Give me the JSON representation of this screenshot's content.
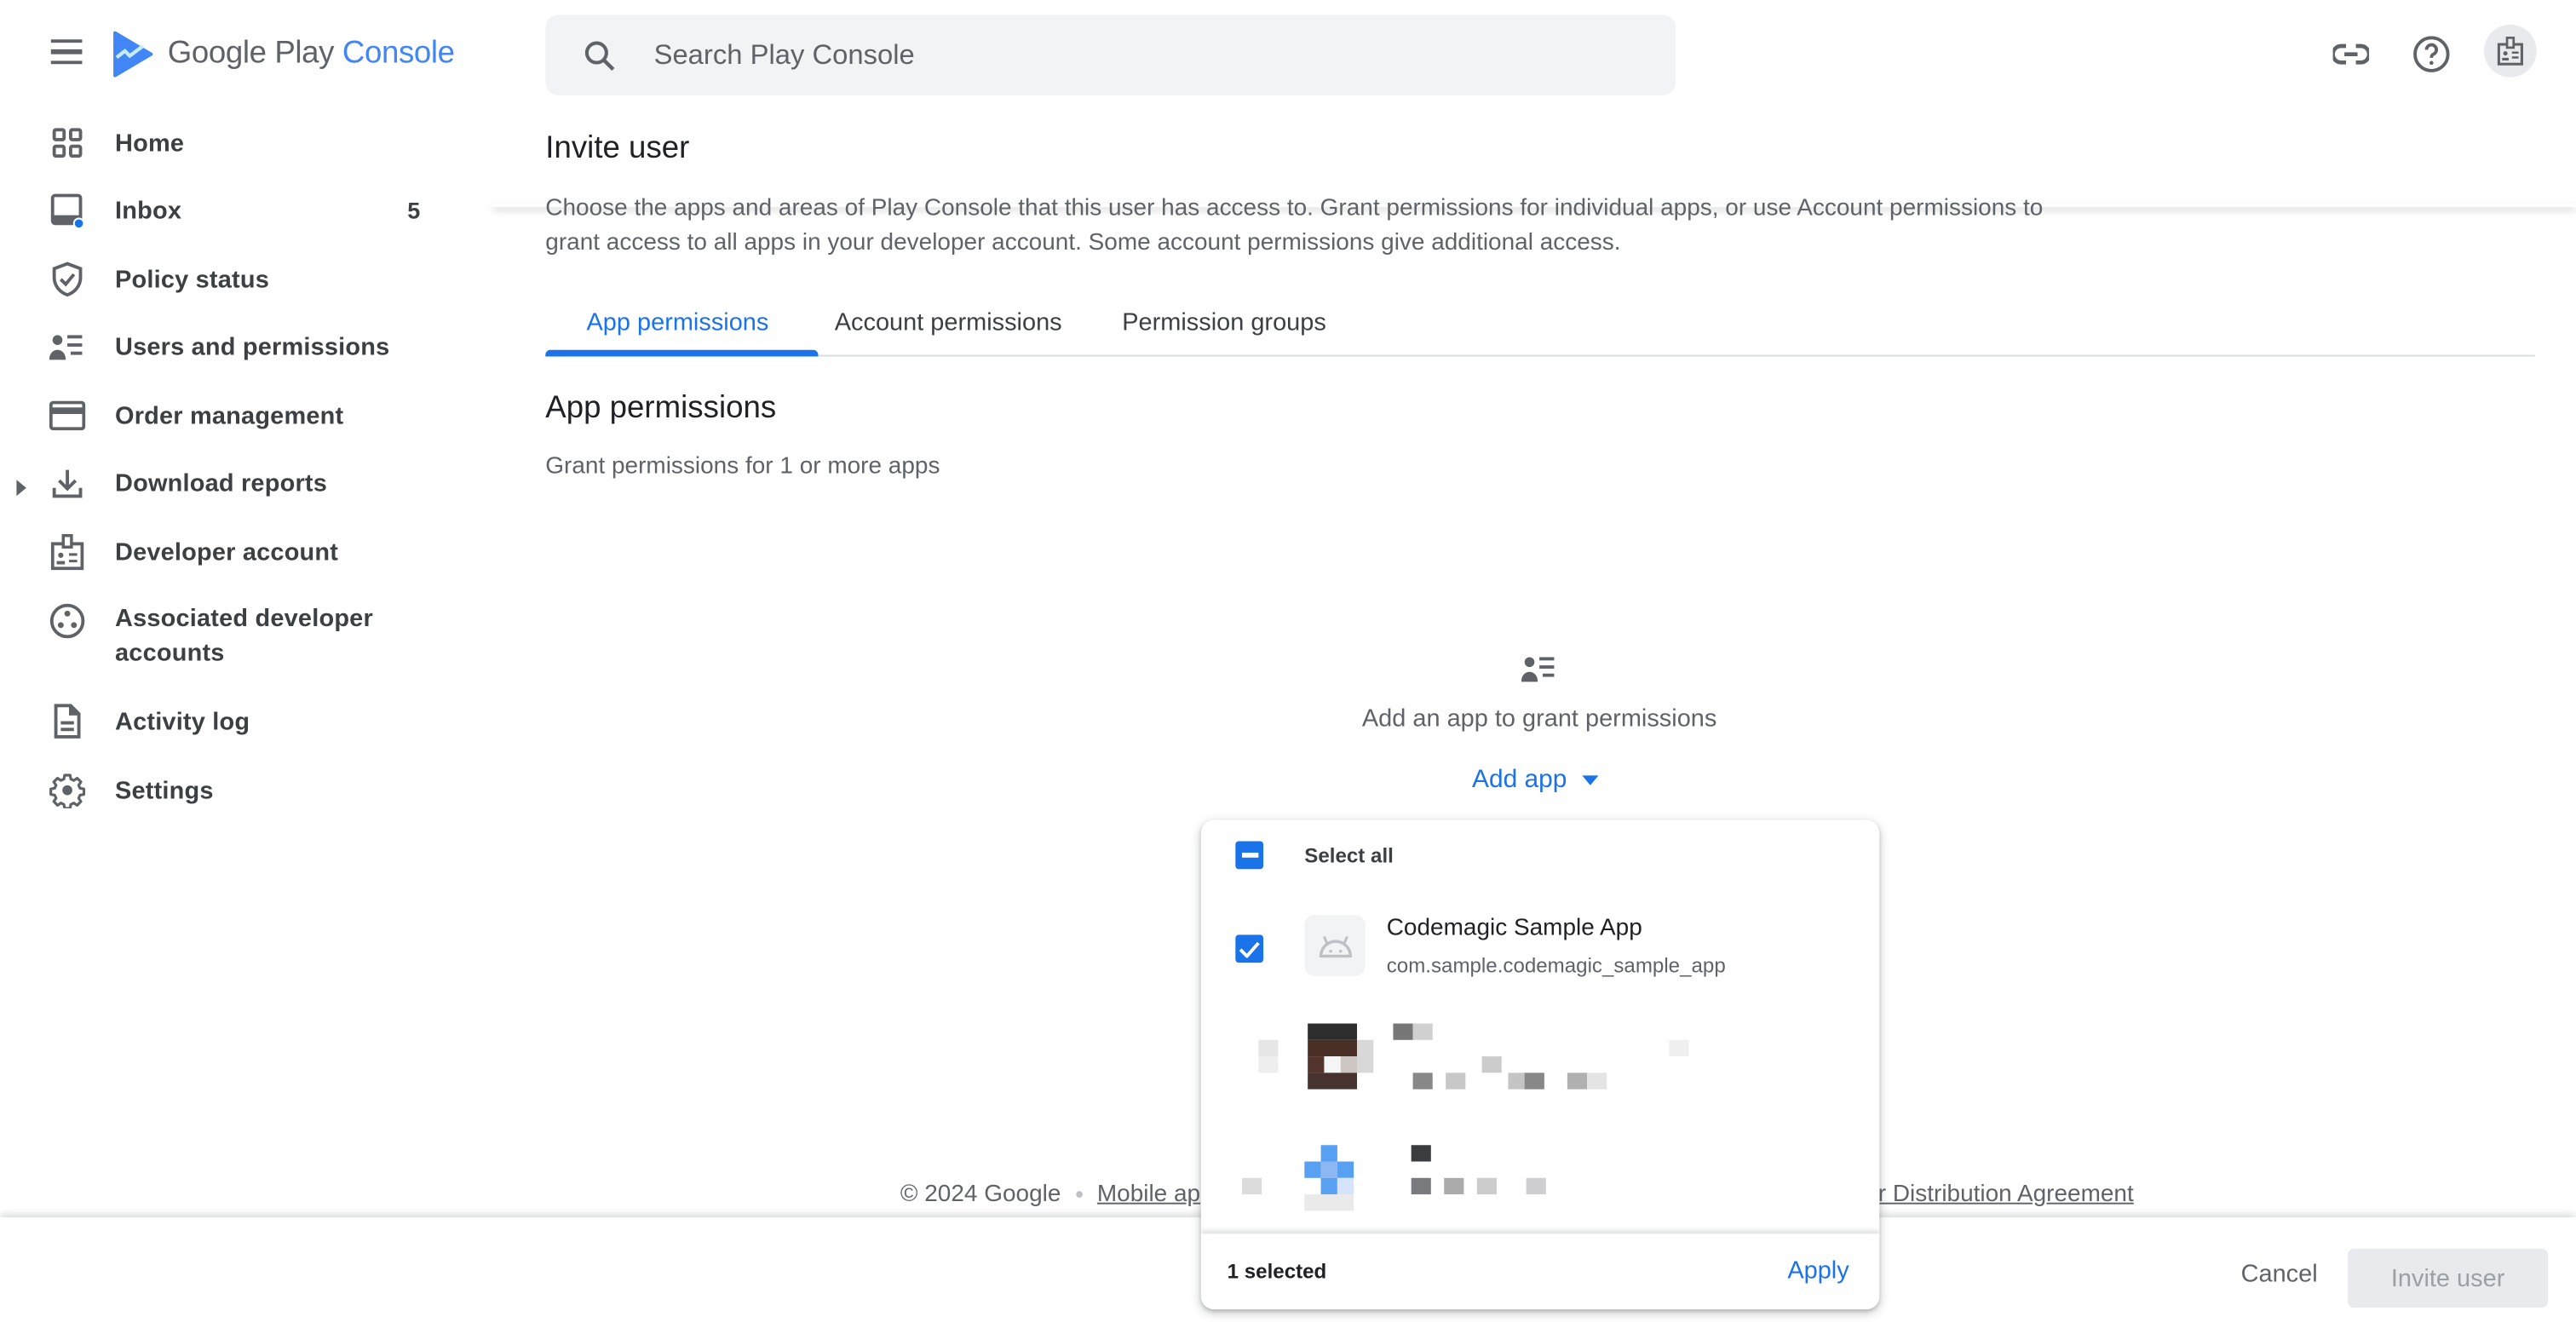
{
  "header": {
    "logo_text_main": "Google Play",
    "logo_text_accent": "Console",
    "search_placeholder": "Search Play Console",
    "icons": [
      "link-icon",
      "help-icon",
      "account-badge-icon"
    ]
  },
  "sidebar": {
    "items": [
      {
        "label": "Home",
        "icon": "home-grid-icon"
      },
      {
        "label": "Inbox",
        "icon": "inbox-icon",
        "badge": "5"
      },
      {
        "label": "Policy status",
        "icon": "shield-check-icon"
      },
      {
        "label": "Users and permissions",
        "icon": "users-list-icon"
      },
      {
        "label": "Order management",
        "icon": "credit-card-icon"
      },
      {
        "label": "Download reports",
        "icon": "download-icon",
        "expandable": true
      },
      {
        "label": "Developer account",
        "icon": "id-badge-icon"
      },
      {
        "label": "Associated developer accounts",
        "icon": "linked-accounts-icon"
      },
      {
        "label": "Activity log",
        "icon": "document-icon"
      },
      {
        "label": "Settings",
        "icon": "gear-icon"
      }
    ]
  },
  "page": {
    "title": "Invite user",
    "description": "Choose the apps and areas of Play Console that this user has access to. Grant permissions for individual apps, or use Account permissions to grant access to all apps in your developer account. Some account permissions give additional access.",
    "tabs": [
      {
        "label": "App permissions",
        "active": true
      },
      {
        "label": "Account permissions",
        "active": false
      },
      {
        "label": "Permission groups",
        "active": false
      }
    ],
    "section_title": "App permissions",
    "section_subtitle": "Grant permissions for 1 or more apps",
    "empty_state_text": "Add an app to grant permissions",
    "add_app_label": "Add app"
  },
  "dropdown": {
    "select_all_label": "Select all",
    "select_all_state": "indeterminate",
    "apps": [
      {
        "name": "Codemagic Sample App",
        "package": "com.sample.codemagic_sample_app",
        "checked": true,
        "redacted": false
      },
      {
        "name": "",
        "package": "",
        "checked": false,
        "redacted": true
      },
      {
        "name": "",
        "package": "",
        "checked": false,
        "redacted": true
      }
    ],
    "selected_count_label": "1 selected",
    "apply_label": "Apply"
  },
  "footer": {
    "copyright": "© 2024 Google",
    "link_mobile": "Mobile ap",
    "link_agreement": "oper Distribution Agreement"
  },
  "actions": {
    "cancel_label": "Cancel",
    "invite_label": "Invite user",
    "invite_enabled": false
  },
  "colors": {
    "accent": "#1a73e8",
    "text": "#3c4043",
    "muted": "#5f6368"
  }
}
